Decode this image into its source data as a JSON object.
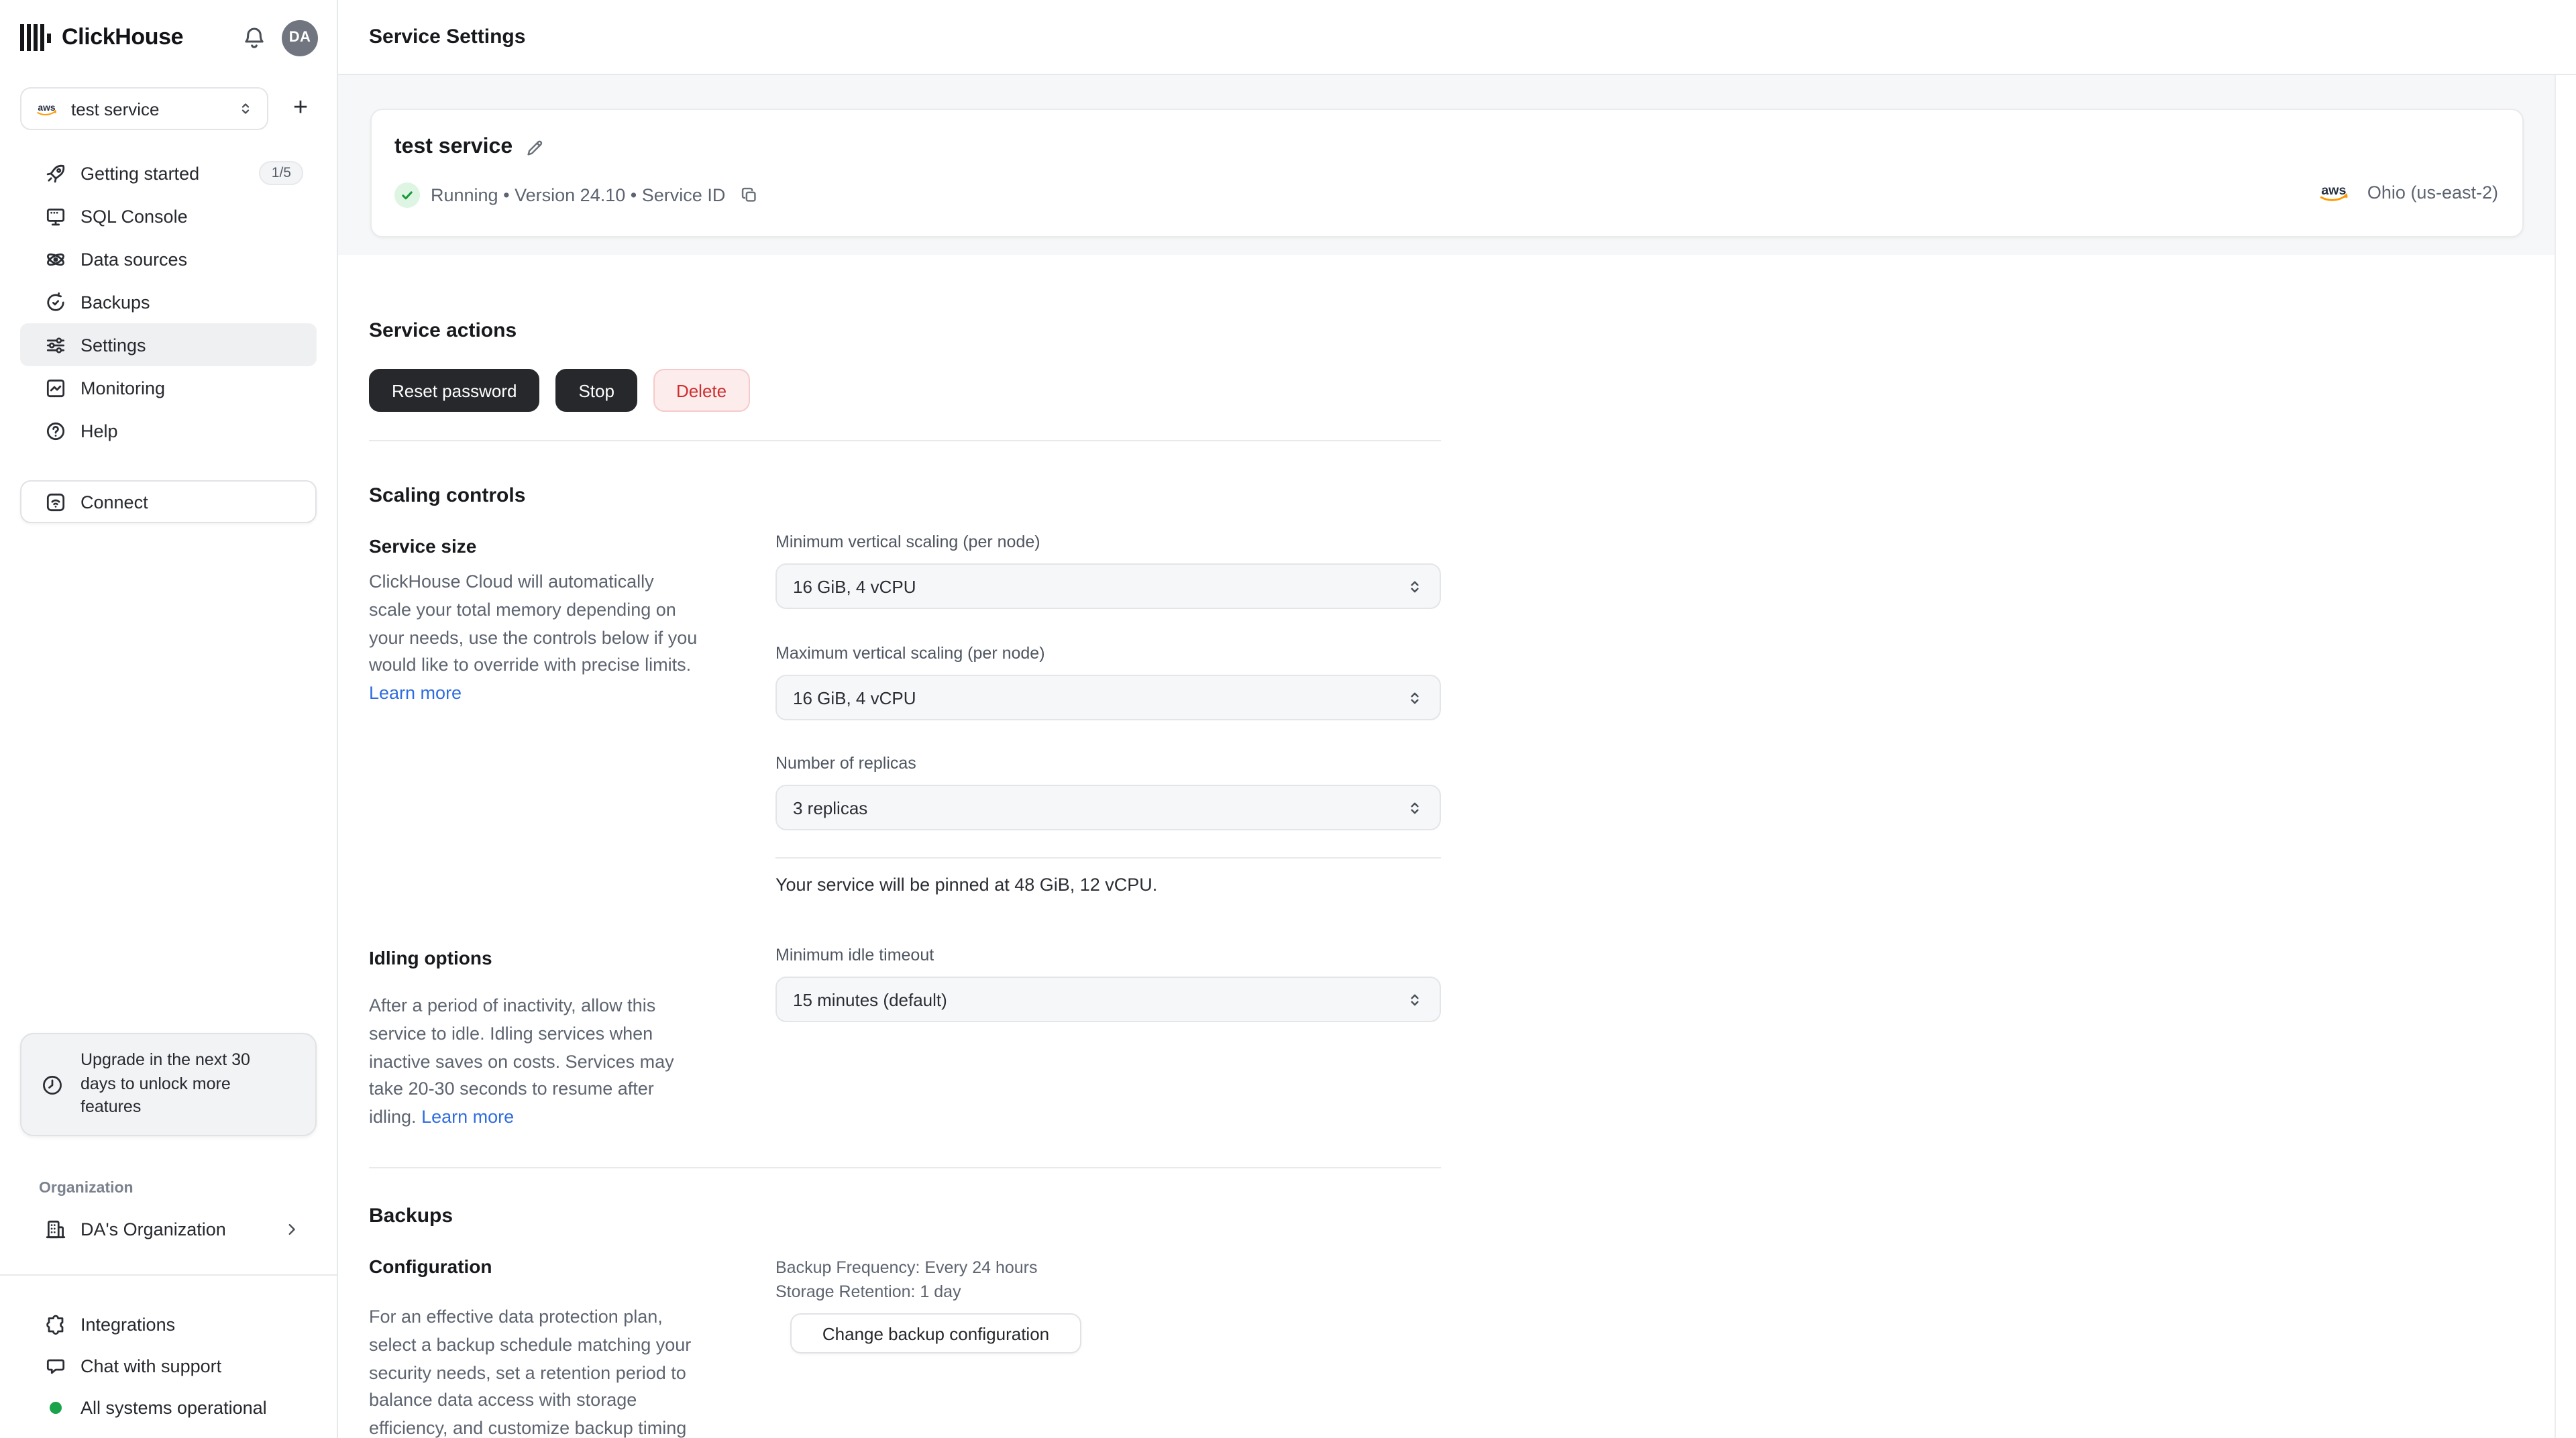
{
  "colors": {
    "accent_blue": "#2f6ce0",
    "danger_red": "#cf2e2e",
    "danger_bg": "#fdecec",
    "success_green": "#1aa34a",
    "dark_button": "#26282b",
    "band_gray": "#f6f7f8",
    "aws_orange": "#ff9900"
  },
  "icons": {
    "logo": "clickhouse-bars",
    "bell": "outline-bell",
    "provider": "aws-smile-logo",
    "selector_chevrons": "chevron-up-down",
    "plus": "plus",
    "nav": [
      "rocket",
      "console-monitor",
      "data-orbit",
      "history-clock",
      "sliders",
      "chart-square",
      "question-circle"
    ],
    "connect": "wifi-square",
    "upgrade": "clock",
    "organization": "building",
    "org_chevron": "chevron-right",
    "integrations": "puzzle",
    "chat": "speech-bubble",
    "status": "green-dot",
    "edit": "pencil",
    "copy": "copy-squares",
    "running": "check-circle"
  },
  "sidebar": {
    "logo_text": "ClickHouse",
    "avatar_initials": "DA",
    "service_selector": {
      "value": "test service"
    },
    "nav": [
      {
        "label": "Getting started",
        "badge": "1/5"
      },
      {
        "label": "SQL Console"
      },
      {
        "label": "Data sources"
      },
      {
        "label": "Backups"
      },
      {
        "label": "Settings"
      },
      {
        "label": "Monitoring"
      },
      {
        "label": "Help"
      }
    ],
    "connect_label": "Connect",
    "upgrade_notice": {
      "line1": "Upgrade in the next 30",
      "line2": "days to unlock more",
      "line3": "features"
    },
    "organization": {
      "section_label": "Organization",
      "name": "DA's Organization"
    },
    "footer": {
      "integrations": "Integrations",
      "chat": "Chat with support",
      "status": "All systems operational"
    }
  },
  "header": {
    "title": "Service Settings"
  },
  "service_card": {
    "name": "test service",
    "status": "Running",
    "separator": "•",
    "version": "Version 24.10",
    "service_id_label": "Service ID",
    "region": "Ohio (us-east-2)"
  },
  "service_actions": {
    "heading": "Service actions",
    "reset_password": "Reset password",
    "stop": "Stop",
    "delete": "Delete"
  },
  "scaling": {
    "heading": "Scaling controls",
    "service_size_heading": "Service size",
    "description": [
      "ClickHouse Cloud will automatically",
      "scale your total memory depending on",
      "your needs, use the controls below if you",
      "would like to override with precise limits."
    ],
    "learn_more": "Learn more",
    "min_label": "Minimum vertical scaling (per node)",
    "min_value": "16 GiB, 4 vCPU",
    "max_label": "Maximum vertical scaling (per node)",
    "max_value": "16 GiB, 4 vCPU",
    "replicas_label": "Number of replicas",
    "replicas_value": "3 replicas",
    "pinned_note": "Your service will be pinned at 48 GiB, 12 vCPU."
  },
  "idling": {
    "heading": "Idling options",
    "description": [
      "After a period of inactivity, allow this",
      "service to idle. Idling services when",
      "inactive saves on costs. Services may",
      "take 20-30 seconds to resume after",
      "idling."
    ],
    "learn_more": "Learn more",
    "timeout_label": "Minimum idle timeout",
    "timeout_value": "15 minutes (default)"
  },
  "backups": {
    "heading": "Backups",
    "config_heading": "Configuration",
    "description": [
      "For an effective data protection plan,",
      "select a backup schedule matching your",
      "security needs, set a retention period to",
      "balance data access with storage",
      "efficiency, and customize backup timing"
    ],
    "frequency": "Backup Frequency: Every 24 hours",
    "retention": "Storage Retention: 1 day",
    "change_button": "Change backup configuration"
  }
}
